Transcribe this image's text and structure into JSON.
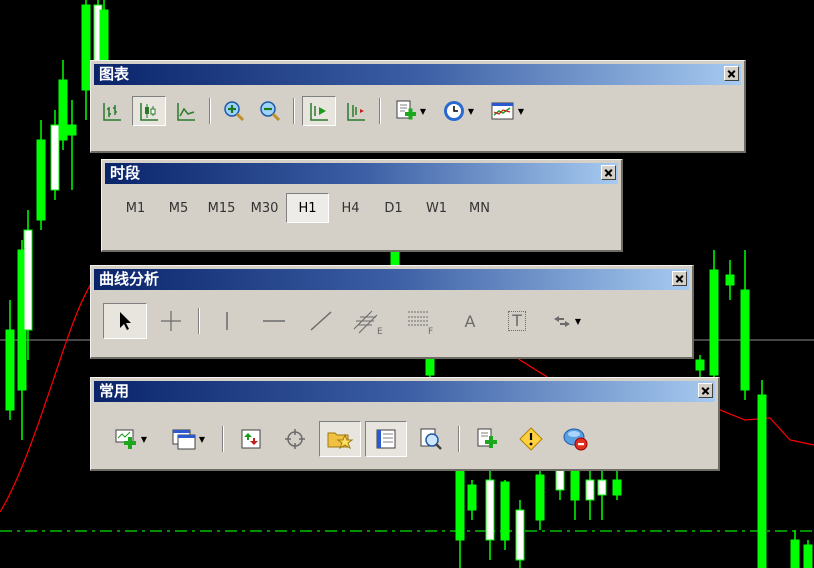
{
  "toolbars": {
    "charts": {
      "title": "图表",
      "buttons": [
        {
          "icon": "bar-chart-icon"
        },
        {
          "icon": "candlestick-chart-icon",
          "pressed": true
        },
        {
          "icon": "line-chart-icon"
        },
        {
          "icon": "zoom-in-icon"
        },
        {
          "icon": "zoom-out-icon"
        },
        {
          "icon": "auto-scroll-icon",
          "pressed": true
        },
        {
          "icon": "chart-shift-icon"
        },
        {
          "icon": "add-indicator-icon",
          "dropdown": true
        },
        {
          "icon": "clock-periods-icon",
          "dropdown": true
        },
        {
          "icon": "templates-icon",
          "dropdown": true
        }
      ]
    },
    "periods": {
      "title": "时段",
      "items": [
        "M1",
        "M5",
        "M15",
        "M30",
        "H1",
        "H4",
        "D1",
        "W1",
        "MN"
      ],
      "selected": "H1"
    },
    "line_studies": {
      "title": "曲线分析",
      "buttons": [
        {
          "icon": "cursor-arrow-icon",
          "pressed": true
        },
        {
          "icon": "crosshair-icon"
        },
        {
          "icon": "vertical-line-icon"
        },
        {
          "icon": "horizontal-line-icon"
        },
        {
          "icon": "trendline-icon"
        },
        {
          "icon": "equidistant-channel-icon",
          "sub": "E"
        },
        {
          "icon": "fibonacci-retracement-icon",
          "sub": "F"
        },
        {
          "icon": "text-icon",
          "label": "A"
        },
        {
          "icon": "text-label-icon",
          "label": "T"
        },
        {
          "icon": "arrows-icon",
          "dropdown": true
        }
      ]
    },
    "standard": {
      "title": "常用",
      "buttons": [
        {
          "icon": "new-chart-icon",
          "dropdown": true
        },
        {
          "icon": "profiles-icon",
          "dropdown": true
        },
        {
          "icon": "market-watch-icon"
        },
        {
          "icon": "data-window-icon"
        },
        {
          "icon": "navigator-icon",
          "pressed": true
        },
        {
          "icon": "terminal-icon",
          "pressed": true
        },
        {
          "icon": "strategy-tester-icon"
        },
        {
          "icon": "new-order-icon"
        },
        {
          "icon": "metaeditor-icon"
        },
        {
          "icon": "autotrading-icon"
        }
      ]
    }
  },
  "colors": {
    "chart_bg": "#000000",
    "candle": "#00ff00",
    "ma_line": "#ff0000",
    "dash_line": "#00ff00",
    "title_grad_start": "#0a246a",
    "title_grad_end": "#a6caf0"
  }
}
